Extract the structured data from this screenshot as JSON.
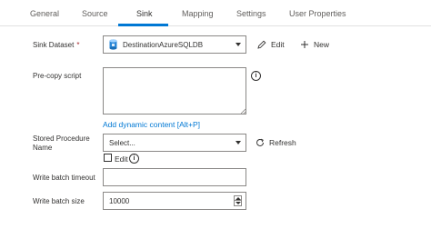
{
  "tabs": [
    {
      "label": "General"
    },
    {
      "label": "Source"
    },
    {
      "label": "Sink",
      "active": true
    },
    {
      "label": "Mapping"
    },
    {
      "label": "Settings"
    },
    {
      "label": "User Properties"
    }
  ],
  "sink_dataset": {
    "label": "Sink Dataset",
    "required_marker": "*",
    "value": "DestinationAzureSQLDB",
    "edit_label": "Edit",
    "new_label": "New"
  },
  "pre_copy_script": {
    "label": "Pre-copy script",
    "value": "",
    "info_glyph": "i",
    "dynamic_link": "Add dynamic content [Alt+P]"
  },
  "stored_procedure": {
    "label_line1": "Stored Procedure",
    "label_line2": "Name",
    "placeholder": "Select...",
    "refresh_label": "Refresh",
    "edit_checkbox_label": "Edit",
    "edit_checked": false,
    "info_glyph": "i"
  },
  "write_batch_timeout": {
    "label": "Write batch timeout",
    "value": ""
  },
  "write_batch_size": {
    "label": "Write batch size",
    "value": "10000"
  },
  "colors": {
    "accent": "#0078d4",
    "required": "#a4262c",
    "text": "#323130",
    "border": "#8a8886"
  }
}
